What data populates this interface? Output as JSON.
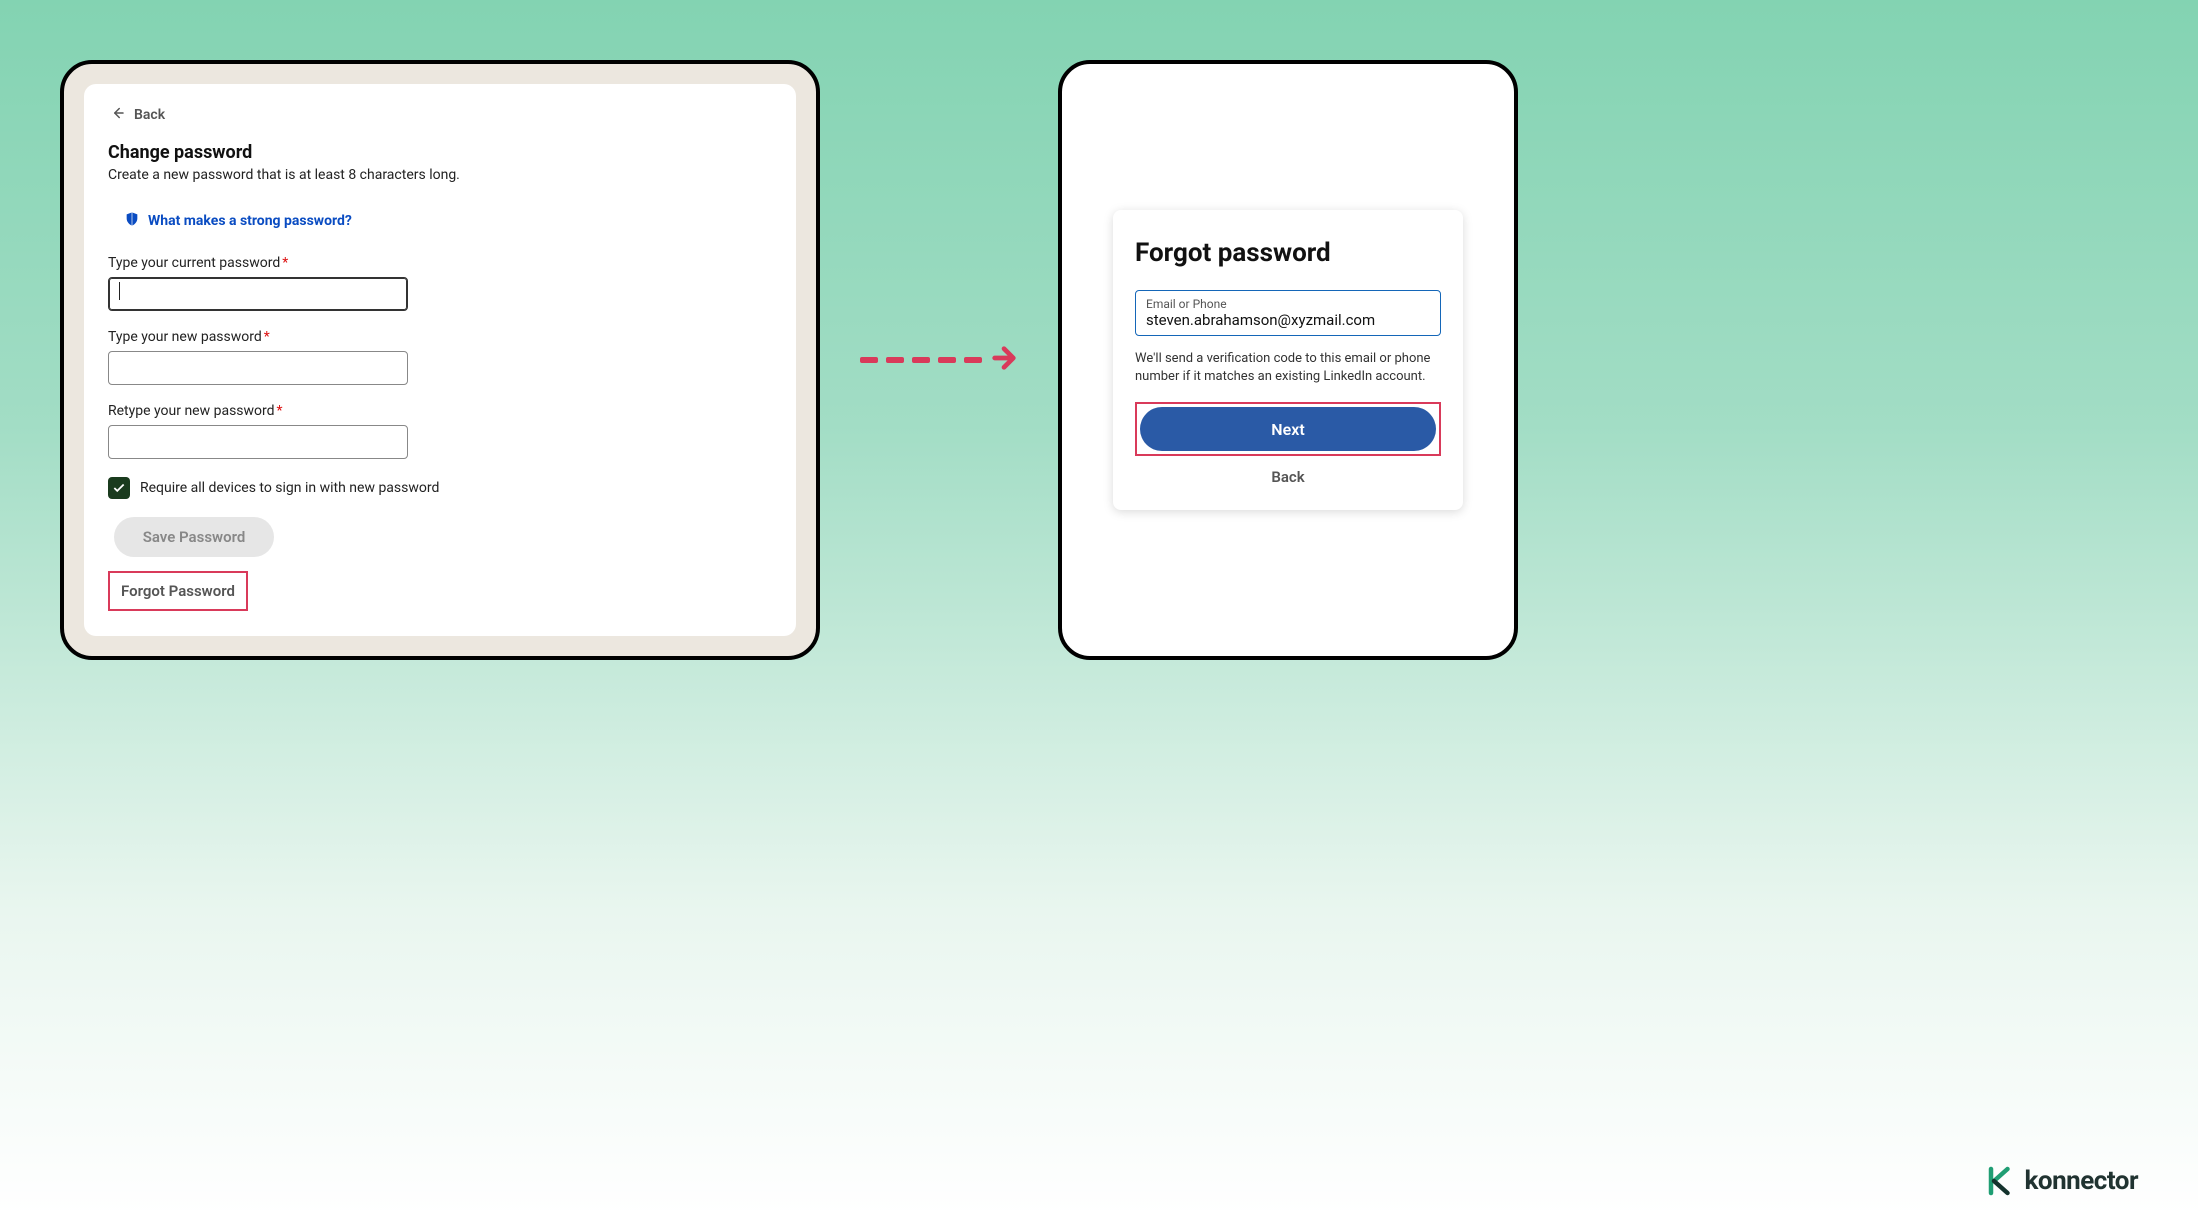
{
  "left": {
    "back_label": "Back",
    "title": "Change password",
    "subtitle": "Create a new password that is at least 8 characters long.",
    "strong_link": "What makes a strong password?",
    "current_label": "Type your current password",
    "new_label": "Type your new password",
    "retype_label": "Retype your new password",
    "require_label": "Require all devices to sign in with new password",
    "save_label": "Save Password",
    "forgot_label": "Forgot Password"
  },
  "right": {
    "title": "Forgot password",
    "input_label": "Email or Phone",
    "input_value": "steven.abrahamson@xyzmail.com",
    "desc": "We'll send a verification code to this email or phone number if it matches an existing LinkedIn account.",
    "next_label": "Next",
    "back_label": "Back"
  },
  "brand": {
    "name": "konnector"
  }
}
